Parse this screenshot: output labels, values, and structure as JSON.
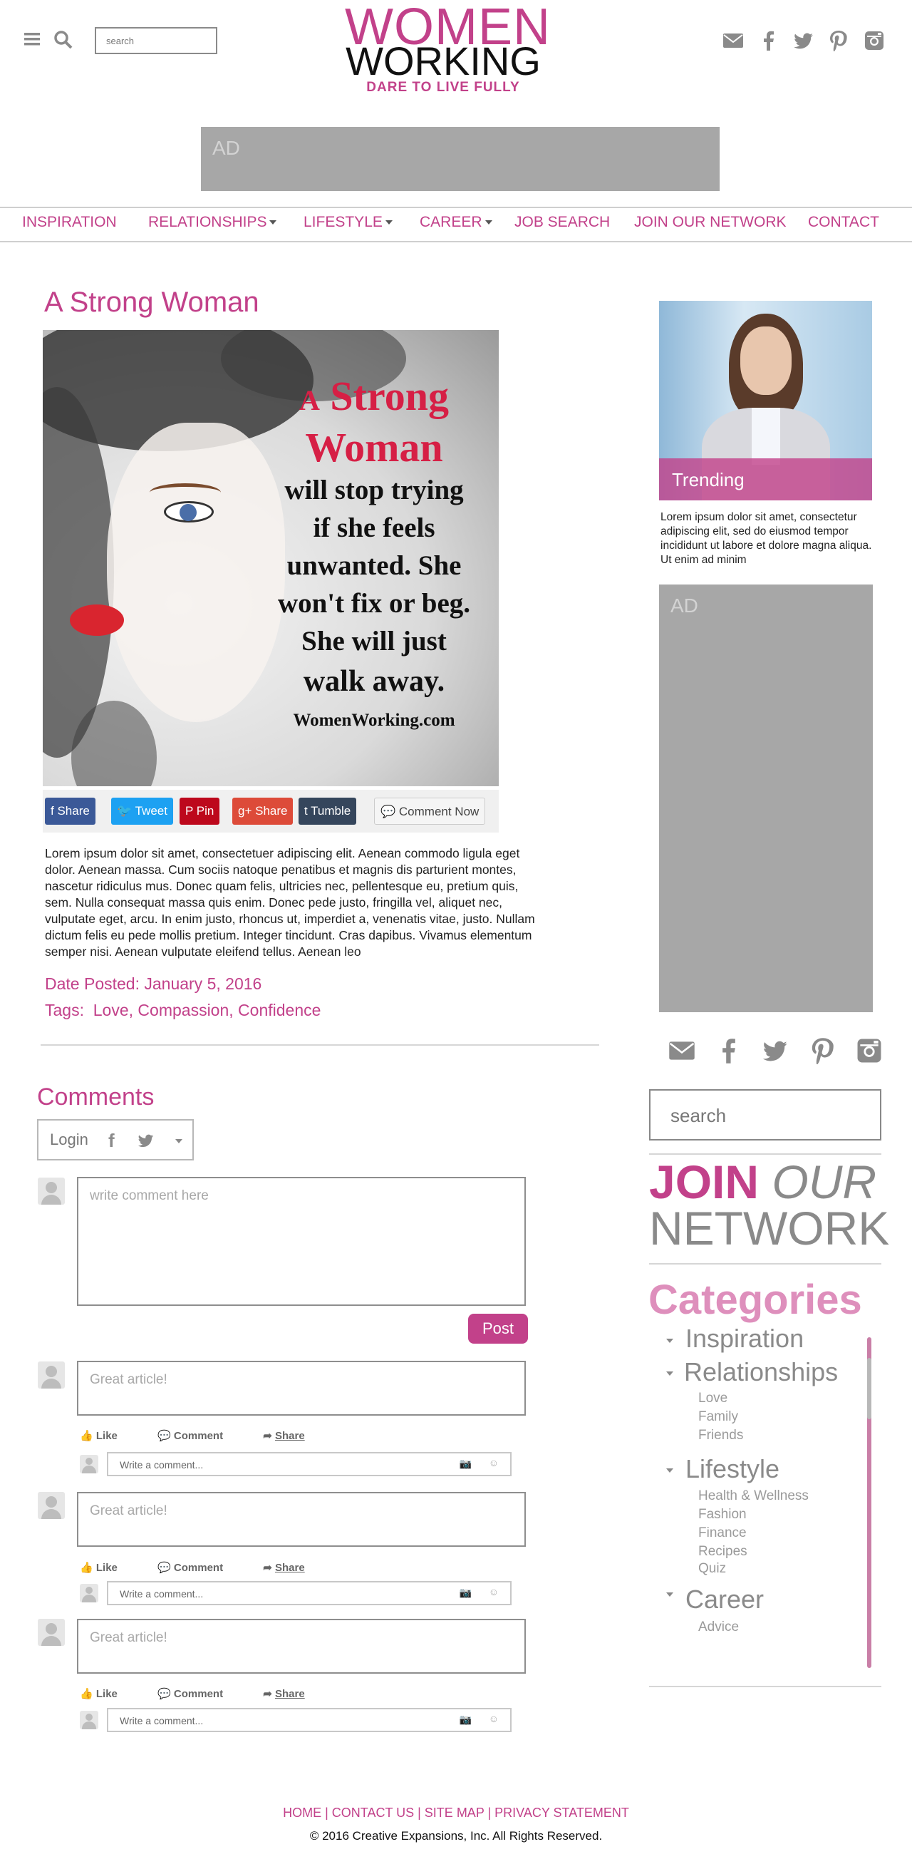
{
  "header": {
    "search_placeholder": "search",
    "logo_line1": "WOMEN",
    "logo_line2": "WORKING",
    "logo_tagline": "DARE TO LIVE FULLY"
  },
  "ads": {
    "top_label": "AD",
    "side_label": "AD"
  },
  "nav": {
    "items": [
      {
        "label": "INSPIRATION",
        "dropdown": false
      },
      {
        "label": "RELATIONSHIPS",
        "dropdown": true
      },
      {
        "label": "LIFESTYLE",
        "dropdown": true
      },
      {
        "label": "CAREER",
        "dropdown": true
      },
      {
        "label": "JOB SEARCH",
        "dropdown": false
      },
      {
        "label": "JOIN OUR NETWORK",
        "dropdown": false
      },
      {
        "label": "CONTACT",
        "dropdown": false
      }
    ]
  },
  "article": {
    "title": "A Strong Woman",
    "image_quote": {
      "line1_a": "A",
      "line1_b": "Strong",
      "line2": "Woman",
      "line3": "will stop trying",
      "line4": "if she feels",
      "line5": "unwanted. She",
      "line6": "won't fix or beg.",
      "line7": "She will just",
      "line8": "walk away.",
      "watermark": "WomenWorking.com"
    },
    "share_buttons": [
      {
        "label": "Share",
        "icon": "facebook-icon",
        "color": "#3b5998"
      },
      {
        "label": "Tweet",
        "icon": "twitter-icon",
        "color": "#1da1f2"
      },
      {
        "label": "Pin",
        "icon": "pinterest-icon",
        "color": "#bd081c"
      },
      {
        "label": "Share",
        "icon": "google-plus-icon",
        "color": "#dd4b39"
      },
      {
        "label": "Tumble",
        "icon": "tumblr-icon",
        "color": "#35465c"
      },
      {
        "label": "Comment Now",
        "icon": "comment-icon",
        "color": "#f5f5f5"
      }
    ],
    "body": "Lorem ipsum dolor sit amet, consectetuer adipiscing elit. Aenean commodo ligula eget dolor. Aenean massa. Cum sociis natoque penatibus et magnis dis parturient montes, nascetur ridiculus mus. Donec quam felis, ultricies nec, pellentesque eu, pretium quis, sem. Nulla consequat massa quis enim. Donec pede justo, fringilla vel, aliquet nec, vulputate eget, arcu. In enim justo, rhoncus ut, imperdiet a, venenatis vitae, justo. Nullam dictum felis eu pede mollis pretium. Integer tincidunt. Cras dapibus. Vivamus elementum semper nisi. Aenean vulputate eleifend tellus. Aenean leo",
    "date_posted": "Date Posted: January 5, 2016",
    "tags_label": "Tags:",
    "tags": "Love, Compassion, Confidence"
  },
  "comments": {
    "title": "Comments",
    "login_label": "Login",
    "new_comment_placeholder": "write comment here",
    "post_label": "Post",
    "items": [
      {
        "text": "Great article!"
      },
      {
        "text": "Great article!"
      },
      {
        "text": "Great article!"
      }
    ],
    "like_label": "Like",
    "comment_label": "Comment",
    "share_label": "Share",
    "reply_placeholder": "Write a comment..."
  },
  "sidebar": {
    "trending_label": "Trending",
    "trending_text": "Lorem ipsum dolor sit amet, consectetur adipiscing elit, sed do eiusmod tempor incididunt ut labore et dolore magna aliqua. Ut enim ad minim",
    "search_placeholder": "search",
    "join_word1": "JOIN",
    "join_word2": "OUR",
    "join_word3": "NETWORK",
    "categories_title": "Categories",
    "categories": [
      {
        "label": "Inspiration",
        "subs": []
      },
      {
        "label": "Relationships",
        "subs": [
          "Love",
          "Family",
          "Friends"
        ]
      },
      {
        "label": "Lifestyle",
        "subs": [
          "Health & Wellness",
          "Fashion",
          "Finance",
          "Recipes",
          "Quiz"
        ]
      },
      {
        "label": "Career",
        "subs": [
          "Advice"
        ]
      }
    ]
  },
  "footer": {
    "links": "HOME | CONTACT US | SITE MAP | PRIVACY STATEMENT",
    "copyright": "© 2016 Creative Expansions, Inc. All Rights Reserved."
  },
  "colors": {
    "brand": "#c2418a",
    "gray_icon": "#8a8a8a",
    "ad_gray": "#a7a7a7"
  }
}
